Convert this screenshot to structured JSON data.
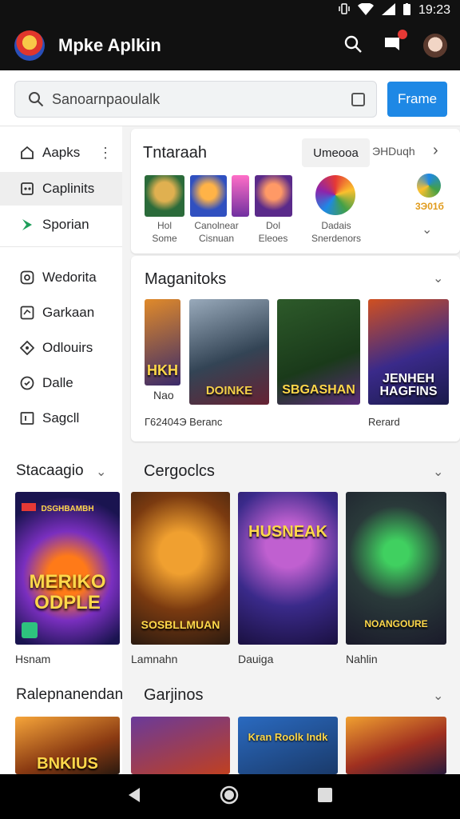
{
  "status": {
    "time": "19:23"
  },
  "app": {
    "title": "Mpke Aplkin"
  },
  "search": {
    "value": "Sanoarnpaoulalk",
    "button": "Frame"
  },
  "sidebar": {
    "items": [
      {
        "label": "Aapks",
        "icon": "home-icon"
      },
      {
        "label": "Caplinits",
        "icon": "gamepad-icon"
      },
      {
        "label": "Sporian",
        "icon": "play-triangle-icon"
      },
      {
        "label": "Wedorita",
        "icon": "circle-square-icon"
      },
      {
        "label": "Garkaan",
        "icon": "image-icon"
      },
      {
        "label": "Odlouirs",
        "icon": "diamond-icon"
      },
      {
        "label": "Dalle",
        "icon": "tag-icon"
      },
      {
        "label": "Sagcll",
        "icon": "bracket-icon"
      }
    ]
  },
  "top_card": {
    "title": "Tntaraah",
    "chip1": "Umeooa",
    "chip2": "ЭНDuqh",
    "apps": [
      {
        "name": "Hol",
        "sub": "Some"
      },
      {
        "name": "Canolnear",
        "sub": "Cisnuan"
      },
      {
        "name": "Dol",
        "sub": "Eleoes"
      },
      {
        "name": "Dadais",
        "sub": "Snerdenors"
      }
    ],
    "extra_value": "3Э01б"
  },
  "mag_card": {
    "title": "Maganitoks",
    "tiles": [
      {
        "title": "HKH",
        "caption": "Nao"
      },
      {
        "title": "DOINKE",
        "caption": ""
      },
      {
        "title": "SBGASHAN",
        "caption": ""
      },
      {
        "title": "JENHEH HAGFINS",
        "caption": ""
      }
    ],
    "caption_left": "Г62404Э Beranc",
    "caption_right": "Rerard"
  },
  "left_section": {
    "title": "Stacaagio",
    "tile_title": "MERIKO ODPLE",
    "tile_top": "DSGHBAMBH",
    "caption": "Hsnam"
  },
  "categories": {
    "title": "Cergoclcs",
    "tiles": [
      {
        "title": "SOSBLLMUAN",
        "caption": "Lamnahn"
      },
      {
        "title": "HUSNEAK",
        "caption": "Dauiga"
      },
      {
        "title": "NOANGOURE",
        "caption": "Nahlin"
      }
    ]
  },
  "bottom": {
    "left_title": "Ralepnanendan",
    "right_title": "Garjinos",
    "tiles": [
      {
        "title": "BNKIUS"
      },
      {
        "title": ""
      },
      {
        "title": "Kran Roolk Indk"
      },
      {
        "title": ""
      }
    ]
  }
}
